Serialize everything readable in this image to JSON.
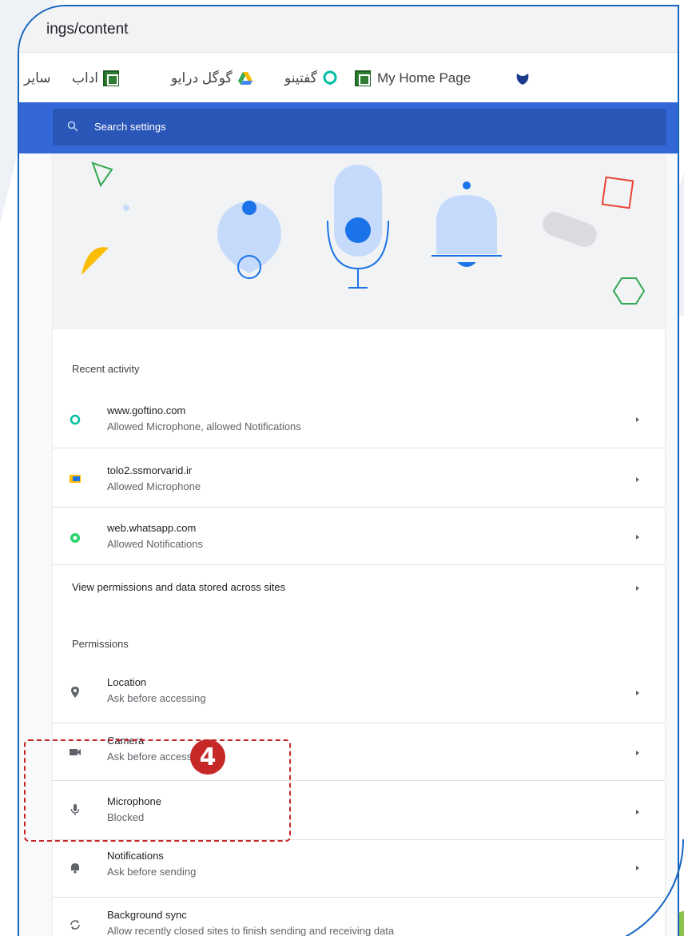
{
  "browser": {
    "url_fragment": "ings/content",
    "bookmarks": [
      {
        "label": "My Home Page",
        "icon": "grid-icon"
      },
      {
        "label": "گفتینو",
        "icon": "chat-bubble-icon"
      },
      {
        "label": "گوگل درایو",
        "icon": "drive-icon"
      },
      {
        "label": "اداب",
        "icon": "grid-icon"
      },
      {
        "label": "سایر",
        "icon": "folder-icon"
      }
    ]
  },
  "search": {
    "placeholder": "Search settings"
  },
  "recent_activity": {
    "title": "Recent activity",
    "items": [
      {
        "site": "www.goftino.com",
        "detail": "Allowed Microphone, allowed Notifications",
        "icon": "goftino-icon"
      },
      {
        "site": "tolo2.ssmorvarid.ir",
        "detail": "Allowed Microphone",
        "icon": "site-favicon-icon"
      },
      {
        "site": "web.whatsapp.com",
        "detail": "Allowed Notifications",
        "icon": "whatsapp-icon"
      }
    ],
    "view_all": "View permissions and data stored across sites"
  },
  "permissions": {
    "title": "Permissions",
    "items": [
      {
        "name": "Location",
        "state": "Ask before accessing",
        "icon": "location-pin-icon"
      },
      {
        "name": "Camera",
        "state": "Ask before accessing",
        "icon": "camera-icon"
      },
      {
        "name": "Microphone",
        "state": "Blocked",
        "icon": "microphone-icon"
      },
      {
        "name": "Notifications",
        "state": "Ask before sending",
        "icon": "bell-icon"
      },
      {
        "name": "Background sync",
        "state": "Allow recently closed sites to finish sending and receiving data",
        "icon": "sync-icon"
      }
    ]
  },
  "annotation": {
    "step": "4"
  },
  "colors": {
    "accent": "#3367d6",
    "highlight": "#c62828",
    "frame": "#1565c0"
  }
}
